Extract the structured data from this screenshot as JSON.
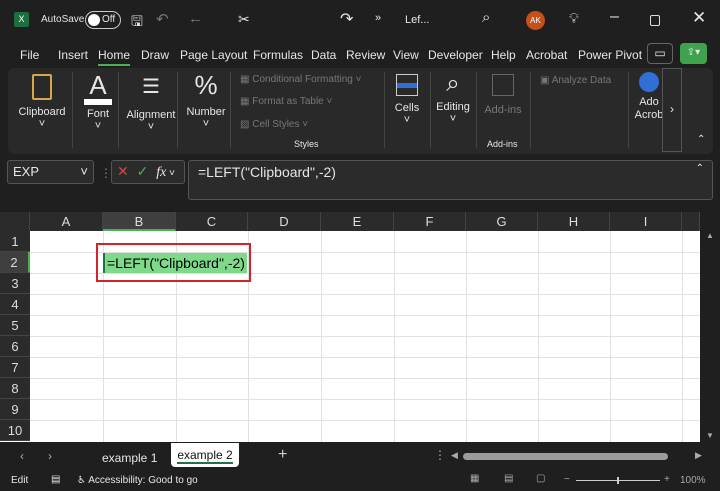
{
  "title_bar": {
    "app_icon": "excel-icon",
    "autosave_label": "AutoSave",
    "autosave_state": "Off",
    "file_name": "Lef...",
    "user_initials": "AK",
    "accent": "#c4501b"
  },
  "menu_tabs": [
    "File",
    "Insert",
    "Home",
    "Draw",
    "Page Layout",
    "Formulas",
    "Data",
    "Review",
    "View",
    "Developer",
    "Help",
    "Acrobat",
    "Power Pivot"
  ],
  "active_tab": "Home",
  "ribbon": {
    "clipboard": "Clipboard",
    "font": "Font",
    "alignment": "Alignment",
    "number": "Number",
    "conditional_formatting": "Conditional Formatting",
    "format_as_table": "Format as Table",
    "cell_styles": "Cell Styles",
    "styles": "Styles",
    "cells": "Cells",
    "editing": "Editing",
    "addins_btn": "Add-ins",
    "addins_group": "Add-ins",
    "analyze_data": "Analyze Data",
    "adobe": "Ado Acrob"
  },
  "formula_bar": {
    "name_box": "EXP",
    "fx": "fx",
    "formula": "=LEFT(\"Clipboard\",-2)"
  },
  "columns": [
    "A",
    "B",
    "C",
    "D",
    "E",
    "F",
    "G",
    "H",
    "I"
  ],
  "rows": [
    "1",
    "2",
    "3",
    "4",
    "5",
    "6",
    "7",
    "8",
    "9",
    "10"
  ],
  "cell_b2": "=LEFT(\"Clipboard\",-2)",
  "sheets": [
    "example 1",
    "example 2"
  ],
  "active_sheet": "example 2",
  "status": {
    "mode": "Edit",
    "accessibility": "Accessibility: Good to go",
    "zoom": "100%"
  }
}
